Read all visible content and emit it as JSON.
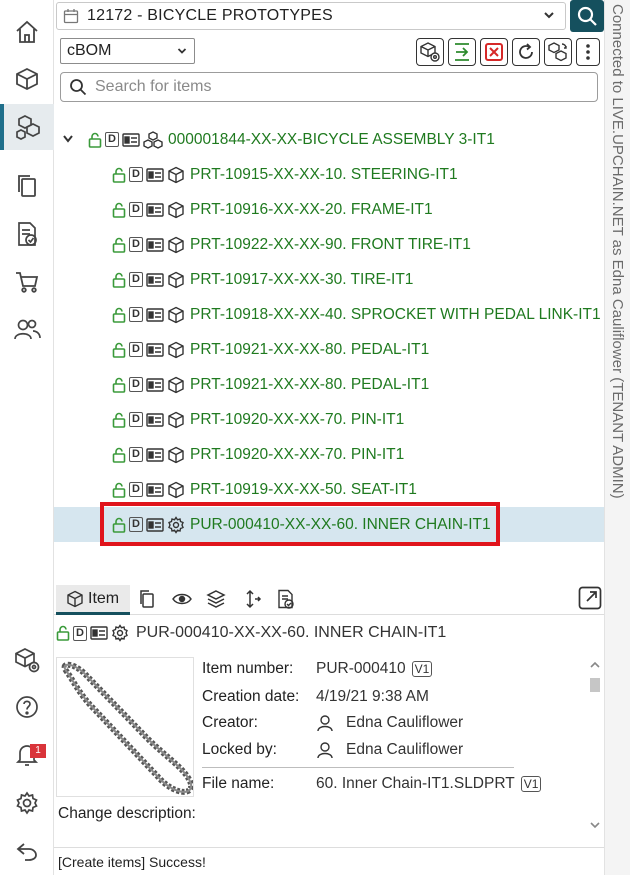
{
  "header": {
    "project": "12172 - BICYCLE PROTOTYPES",
    "bom_select": "cBOM",
    "search_placeholder": "Search for items"
  },
  "connection": "Connected to LIVE.UPCHAIN.NET as Edna Cauliflower (TENANT ADMIN)",
  "nav": {
    "items": [
      "home-icon",
      "item-icon",
      "structure-icon",
      "documents-icon",
      "change-icon",
      "cart-icon",
      "users-icon"
    ],
    "bottom": [
      "item-settings-icon",
      "help-icon",
      "notifications-icon",
      "settings-icon",
      "logout-icon"
    ],
    "notification_count": "1"
  },
  "tree": {
    "root": "000001844-XX-XX-BICYCLE ASSEMBLY 3-IT1",
    "children": [
      {
        "label": "PRT-10915-XX-XX-10. STEERING-IT1",
        "kind": "part"
      },
      {
        "label": "PRT-10916-XX-XX-20. FRAME-IT1",
        "kind": "part"
      },
      {
        "label": "PRT-10922-XX-XX-90. FRONT TIRE-IT1",
        "kind": "part"
      },
      {
        "label": "PRT-10917-XX-XX-30. TIRE-IT1",
        "kind": "part"
      },
      {
        "label": "PRT-10918-XX-XX-40. SPROCKET WITH PEDAL LINK-IT1",
        "kind": "part"
      },
      {
        "label": "PRT-10921-XX-XX-80. PEDAL-IT1",
        "kind": "part"
      },
      {
        "label": "PRT-10921-XX-XX-80. PEDAL-IT1",
        "kind": "part"
      },
      {
        "label": "PRT-10920-XX-XX-70. PIN-IT1",
        "kind": "part"
      },
      {
        "label": "PRT-10920-XX-XX-70. PIN-IT1",
        "kind": "part"
      },
      {
        "label": "PRT-10919-XX-XX-50. SEAT-IT1",
        "kind": "part"
      },
      {
        "label": "PUR-000410-XX-XX-60. INNER CHAIN-IT1",
        "kind": "purchased"
      }
    ]
  },
  "detail": {
    "tab_item": "Item",
    "title": "PUR-000410-XX-XX-60. INNER CHAIN-IT1",
    "labels": {
      "item_number": "Item number:",
      "creation_date": "Creation date:",
      "creator": "Creator:",
      "locked_by": "Locked by:",
      "file_name": "File name:",
      "change_description": "Change description:"
    },
    "values": {
      "item_number": "PUR-000410",
      "item_version": "V1",
      "creation_date": "4/19/21 9:38 AM",
      "creator": "Edna Cauliflower",
      "locked_by": "Edna Cauliflower",
      "file_name": "60. Inner Chain-IT1.SLDPRT",
      "file_version": "V1"
    }
  },
  "status": "[Create items] Success!",
  "colors": {
    "accent": "#15505e",
    "tree_text": "#1f7a1f",
    "selection": "#d6e6ef",
    "highlight": "#e0141c",
    "badge": "#d9343a"
  }
}
